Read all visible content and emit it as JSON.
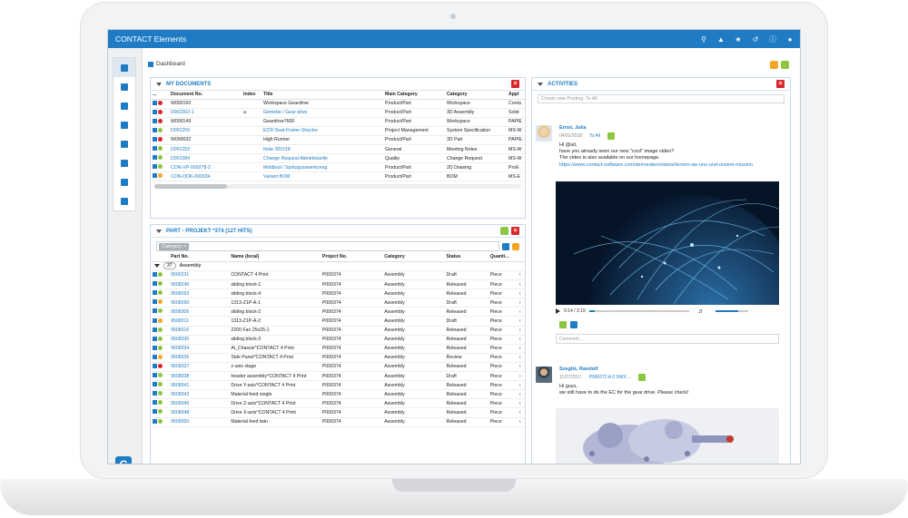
{
  "app": {
    "title": "CONTACT Elements"
  },
  "breadcrumb": {
    "label": "Dashboard"
  },
  "topbar_icons": [
    "search-icon",
    "bell-icon",
    "star-icon",
    "history-icon",
    "info-icon",
    "user-icon"
  ],
  "colors": {
    "brand": "#1f7cc4",
    "danger": "#d9262c",
    "success": "#8dc63f",
    "warning": "#f5a623"
  },
  "my_documents": {
    "title": "MY DOCUMENTS",
    "columns": [
      "Document No.",
      "Index",
      "Title",
      "Main Category",
      "Category",
      "Appl"
    ],
    "rows": [
      {
        "status": "red",
        "no": "W000150",
        "index": "",
        "title": "Workspace Geardrive",
        "main": "Product/Part",
        "cat": "Workspace",
        "app": "Conta",
        "link": false
      },
      {
        "status": "red",
        "no": "D002302-1",
        "index": "a",
        "title": "Getriebe / Gear drive",
        "main": "Product/Part",
        "cat": "3D Assembly",
        "app": "Solid",
        "link": true
      },
      {
        "status": "red",
        "no": "W000149",
        "index": "",
        "title": "Geardrive7600",
        "main": "Product/Part",
        "cat": "Workspace",
        "app": "PAPIE",
        "link": false
      },
      {
        "status": "green",
        "no": "D001250",
        "index": "",
        "title": "ECR-Seat-Frame-Structre",
        "main": "Project Management",
        "cat": "System Specification",
        "app": "MS-W",
        "link": true
      },
      {
        "status": "red",
        "no": "W000032",
        "index": "",
        "title": "High Runner",
        "main": "Product/Part",
        "cat": "3D Part",
        "app": "PAPIE",
        "link": false
      },
      {
        "status": "green",
        "no": "D001253",
        "index": "",
        "title": "Note 281018",
        "main": "General",
        "cat": "Meeting Notes",
        "app": "MS-W",
        "link": true
      },
      {
        "status": "green",
        "no": "D001084",
        "index": "",
        "title": "Change Request Abtriebswelle",
        "main": "Quality",
        "cat": "Change Request",
        "app": "MS-W",
        "link": true
      },
      {
        "status": "green",
        "no": "CON-VP-000278-2",
        "index": "",
        "title": "Moldtool / Spritzgusswerkzeug",
        "main": "Product/Part",
        "cat": "2D Drawing",
        "app": "ProE",
        "link": true
      },
      {
        "status": "orange",
        "no": "CON-DOK-000034",
        "index": "",
        "title": "Variant BOM",
        "main": "Product/Part",
        "cat": "BOM",
        "app": "MS-E",
        "link": true
      }
    ]
  },
  "part_list": {
    "title": "PART - PROJEKT *374 (127 HITS)",
    "filter_chip": "Category ×",
    "columns": [
      "Part No.",
      "Name (local)",
      "Project No.",
      "Category",
      "Status",
      "Quanti..."
    ],
    "group": {
      "count": "37",
      "label": "Assembly"
    },
    "rows": [
      {
        "s": "green",
        "no": "9500231",
        "name": "CONTACT 4 Print",
        "proj": "P000374",
        "cat": "Assembly",
        "status": "Draft",
        "qty": "Piece"
      },
      {
        "s": "green",
        "no": "9508245",
        "name": "sliding block-1",
        "proj": "P000374",
        "cat": "Assembly",
        "status": "Released",
        "qty": "Piece"
      },
      {
        "s": "green",
        "no": "9508263",
        "name": "sliding block-4",
        "proj": "P000374",
        "cat": "Assembly",
        "status": "Released",
        "qty": "Piece"
      },
      {
        "s": "orange",
        "no": "9508290",
        "name": "1313-Z1P-A-1",
        "proj": "P000374",
        "cat": "Assembly",
        "status": "Draft",
        "qty": "Piece"
      },
      {
        "s": "green",
        "no": "9508305",
        "name": "sliding block-2",
        "proj": "P000374",
        "cat": "Assembly",
        "status": "Released",
        "qty": "Piece"
      },
      {
        "s": "orange",
        "no": "9508311",
        "name": "1313-Z1P-A-2",
        "proj": "P000374",
        "cat": "Assembly",
        "status": "Draft",
        "qty": "Piece"
      },
      {
        "s": "green",
        "no": "9508316",
        "name": "2200 Fan 25x25-1",
        "proj": "P000374",
        "cat": "Assembly",
        "status": "Released",
        "qty": "Piece"
      },
      {
        "s": "green",
        "no": "9508330",
        "name": "sliding block-3",
        "proj": "P000374",
        "cat": "Assembly",
        "status": "Released",
        "qty": "Piece"
      },
      {
        "s": "green",
        "no": "9508334",
        "name": "Al_Chassis^CONTACT 4 Print",
        "proj": "P000374",
        "cat": "Assembly",
        "status": "Released",
        "qty": "Piece"
      },
      {
        "s": "orange",
        "no": "9508335",
        "name": "Side Panel^CONTACT 4 Print",
        "proj": "P000374",
        "cat": "Assembly",
        "status": "Review",
        "qty": "Piece"
      },
      {
        "s": "red",
        "no": "9508337",
        "name": "z-axis stage",
        "proj": "P000374",
        "cat": "Assembly",
        "status": "Released",
        "qty": "Piece"
      },
      {
        "s": "green",
        "no": "9508338",
        "name": "header assembly^CONTACT 4 Print",
        "proj": "P000374",
        "cat": "Assembly",
        "status": "Draft",
        "qty": "Piece"
      },
      {
        "s": "green",
        "no": "9508341",
        "name": "Drive Y-axis^CONTACT 4 Print",
        "proj": "P000374",
        "cat": "Assembly",
        "status": "Released",
        "qty": "Piece"
      },
      {
        "s": "green",
        "no": "9508342",
        "name": "Material feed single",
        "proj": "P000374",
        "cat": "Assembly",
        "status": "Released",
        "qty": "Piece"
      },
      {
        "s": "green",
        "no": "9508345",
        "name": "Drive Z-axis^CONTACT 4 Print",
        "proj": "P000374",
        "cat": "Assembly",
        "status": "Released",
        "qty": "Piece"
      },
      {
        "s": "green",
        "no": "9508348",
        "name": "Drive X-axis^CONTACT 4 Print",
        "proj": "P000374",
        "cat": "Assembly",
        "status": "Released",
        "qty": "Piece"
      },
      {
        "s": "green",
        "no": "9508350",
        "name": "Material feed twin",
        "proj": "P000374",
        "cat": "Assembly",
        "status": "Released",
        "qty": "Piece"
      }
    ]
  },
  "activities": {
    "title": "ACTIVITIES",
    "new_posting_placeholder": "Create new Posting: To All",
    "post1": {
      "author": "Ernst, Julia",
      "date": "04/01/2018",
      "to": "To All",
      "lines": [
        "Hi @all,",
        "have you already seen our new \"cool\" image video?",
        "The video is also available on our homepage."
      ],
      "link": "https://www.contact-software.com/de/medien/videos/lernen-sie-uns-und-unsere-mission",
      "video_time": "0:14 / 3:19",
      "video_progress": 0.06,
      "volume": 0.7,
      "comment_placeholder": "Comment..."
    },
    "post2": {
      "author": "Szegliś, Randolf",
      "date": "11/27/2017",
      "ref": "P000272 A 0 SWX ...",
      "lines": [
        "Hi guys,",
        "we still have to do the EC for the gear drive. Please check!"
      ]
    }
  }
}
